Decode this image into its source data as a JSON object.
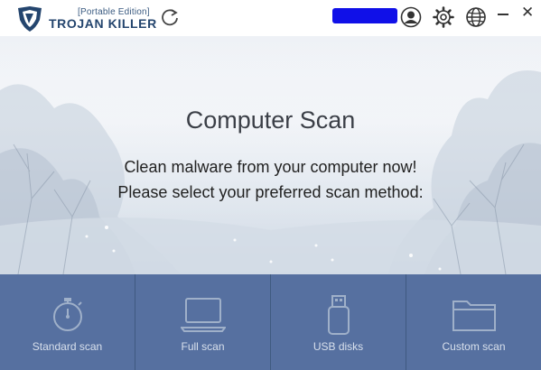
{
  "app": {
    "edition": "[Portable Edition]",
    "brand": "TROJAN KILLER"
  },
  "titlebar": {
    "icons": [
      "shield-logo-icon",
      "refresh-icon",
      "user-icon",
      "gear-icon",
      "globe-icon",
      "minimize-icon",
      "close-icon"
    ],
    "close_glyph": "✕"
  },
  "hero": {
    "title": "Computer Scan",
    "line1": "Clean malware from your computer now!",
    "line2": "Please select your preferred scan method:"
  },
  "scan_methods": [
    {
      "label": "Standard scan",
      "icon": "stopwatch-icon"
    },
    {
      "label": "Full scan",
      "icon": "laptop-icon"
    },
    {
      "label": "USB disks",
      "icon": "usb-drive-icon"
    },
    {
      "label": "Custom scan",
      "icon": "folder-icon"
    }
  ],
  "colors": {
    "brand": "#24456e",
    "tile_bg": "#5670a0",
    "tile_divider": "#3f5a80",
    "tile_text": "#d8e0ec"
  }
}
